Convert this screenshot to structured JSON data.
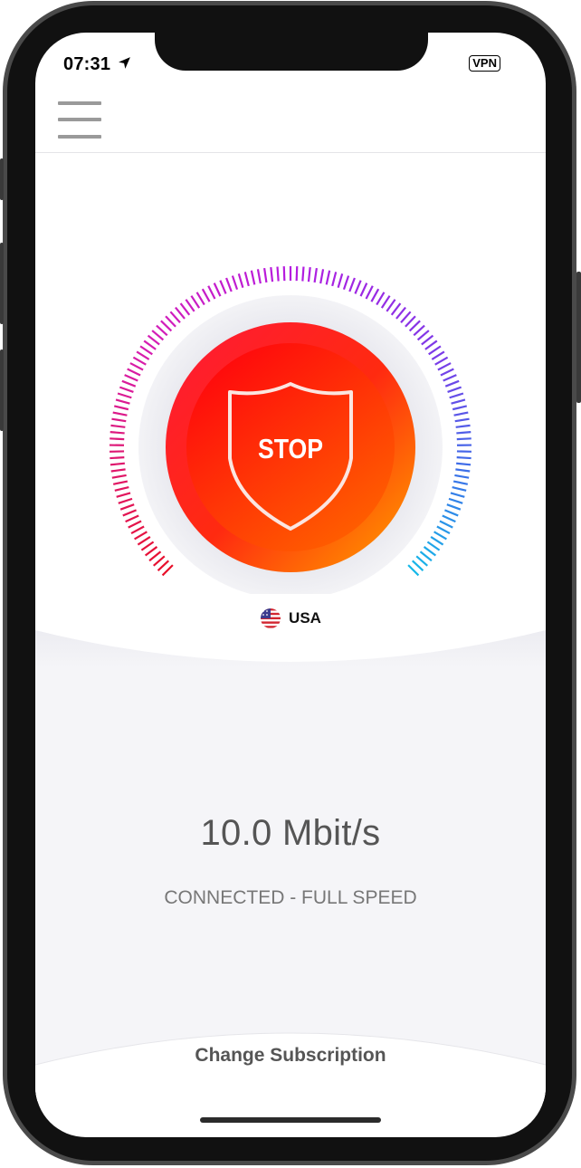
{
  "status_bar": {
    "time": "07:31",
    "vpn_badge": "VPN"
  },
  "connect_button": {
    "label": "STOP"
  },
  "location": {
    "country": "USA"
  },
  "connection": {
    "speed": "10.0 Mbit/s",
    "status": "CONNECTED - FULL SPEED"
  },
  "footer": {
    "subscription_label": "Change Subscription"
  },
  "colors": {
    "button_red": "#ff1010",
    "button_orange": "#ff8a00",
    "gauge_start": "#e8102a",
    "gauge_mid": "#b51be0",
    "gauge_end": "#16b8e8",
    "panel_bg": "#f5f5f8"
  },
  "icons": {
    "menu": "hamburger-icon",
    "location": "location-arrow-icon",
    "shield": "shield-icon",
    "flag": "us-flag-icon"
  }
}
